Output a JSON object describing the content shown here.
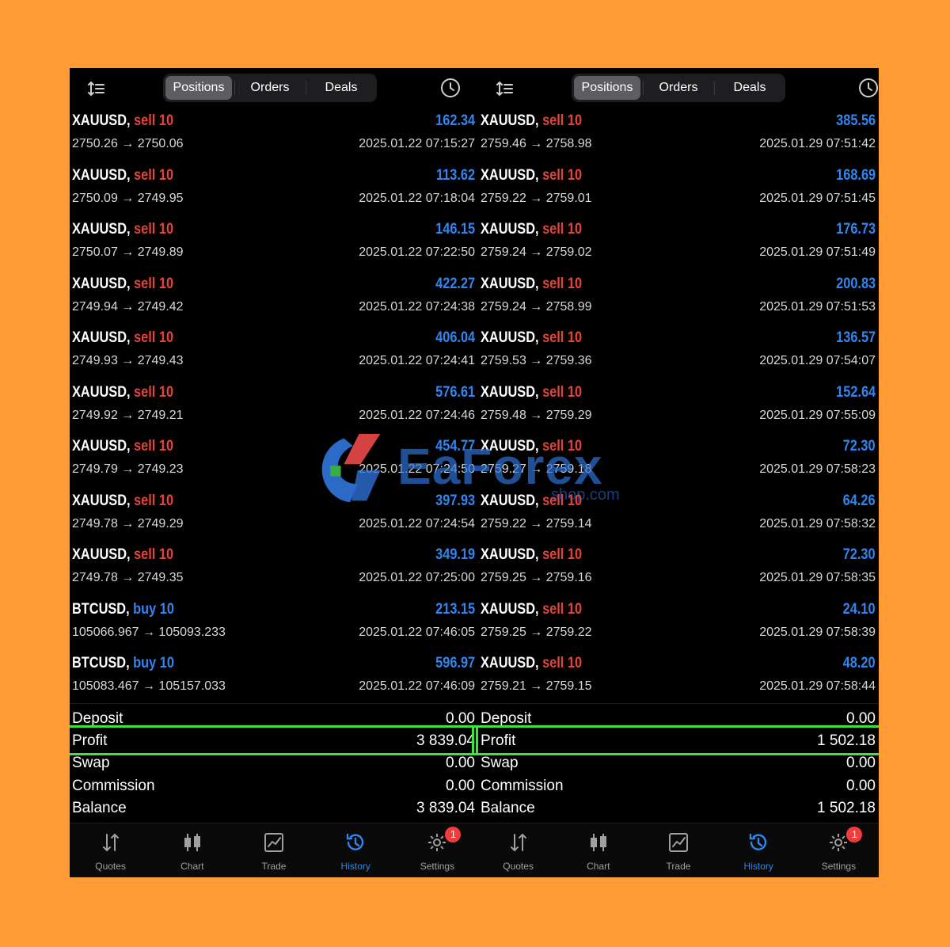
{
  "colors": {
    "background": "#FF9B35",
    "profit_blue": "#2F86F0",
    "sell_red": "#E3443A",
    "highlight_green": "#3CE43C",
    "badge_red": "#F23B3B"
  },
  "panels": [
    {
      "tabs": [
        "Positions",
        "Orders",
        "Deals"
      ],
      "active_tab": "Positions",
      "trades": [
        {
          "symbol": "XAUUSD,",
          "direction": "sell",
          "lots": "10",
          "profit": "162.34",
          "prices": "2750.26 → 2750.06",
          "time": "2025.01.22 07:15:27"
        },
        {
          "symbol": "XAUUSD,",
          "direction": "sell",
          "lots": "10",
          "profit": "113.62",
          "prices": "2750.09 → 2749.95",
          "time": "2025.01.22 07:18:04"
        },
        {
          "symbol": "XAUUSD,",
          "direction": "sell",
          "lots": "10",
          "profit": "146.15",
          "prices": "2750.07 → 2749.89",
          "time": "2025.01.22 07:22:50"
        },
        {
          "symbol": "XAUUSD,",
          "direction": "sell",
          "lots": "10",
          "profit": "422.27",
          "prices": "2749.94 → 2749.42",
          "time": "2025.01.22 07:24:38"
        },
        {
          "symbol": "XAUUSD,",
          "direction": "sell",
          "lots": "10",
          "profit": "406.04",
          "prices": "2749.93 → 2749.43",
          "time": "2025.01.22 07:24:41"
        },
        {
          "symbol": "XAUUSD,",
          "direction": "sell",
          "lots": "10",
          "profit": "576.61",
          "prices": "2749.92 → 2749.21",
          "time": "2025.01.22 07:24:46"
        },
        {
          "symbol": "XAUUSD,",
          "direction": "sell",
          "lots": "10",
          "profit": "454.77",
          "prices": "2749.79 → 2749.23",
          "time": "2025.01.22 07:24:50"
        },
        {
          "symbol": "XAUUSD,",
          "direction": "sell",
          "lots": "10",
          "profit": "397.93",
          "prices": "2749.78 → 2749.29",
          "time": "2025.01.22 07:24:54"
        },
        {
          "symbol": "XAUUSD,",
          "direction": "sell",
          "lots": "10",
          "profit": "349.19",
          "prices": "2749.78 → 2749.35",
          "time": "2025.01.22 07:25:00"
        },
        {
          "symbol": "BTCUSD,",
          "direction": "buy",
          "lots": "10",
          "profit": "213.15",
          "prices": "105066.967 → 105093.233",
          "time": "2025.01.22 07:46:05"
        },
        {
          "symbol": "BTCUSD,",
          "direction": "buy",
          "lots": "10",
          "profit": "596.97",
          "prices": "105083.467 → 105157.033",
          "time": "2025.01.22 07:46:09"
        }
      ],
      "summary": [
        {
          "label": "Deposit",
          "value": "0.00"
        },
        {
          "label": "Profit",
          "value": "3 839.04"
        },
        {
          "label": "Swap",
          "value": "0.00"
        },
        {
          "label": "Commission",
          "value": "0.00"
        },
        {
          "label": "Balance",
          "value": "3 839.04"
        }
      ],
      "nav": [
        {
          "label": "Quotes",
          "icon": "quotes-icon"
        },
        {
          "label": "Chart",
          "icon": "chart-icon"
        },
        {
          "label": "Trade",
          "icon": "trade-icon"
        },
        {
          "label": "History",
          "icon": "history-icon"
        },
        {
          "label": "Settings",
          "icon": "settings-icon",
          "badge": "1"
        }
      ],
      "active_nav": "History"
    },
    {
      "tabs": [
        "Positions",
        "Orders",
        "Deals"
      ],
      "active_tab": "Positions",
      "trades": [
        {
          "symbol": "XAUUSD,",
          "direction": "sell",
          "lots": "10",
          "profit": "385.56",
          "prices": "2759.46 → 2758.98",
          "time": "2025.01.29 07:51:42"
        },
        {
          "symbol": "XAUUSD,",
          "direction": "sell",
          "lots": "10",
          "profit": "168.69",
          "prices": "2759.22 → 2759.01",
          "time": "2025.01.29 07:51:45"
        },
        {
          "symbol": "XAUUSD,",
          "direction": "sell",
          "lots": "10",
          "profit": "176.73",
          "prices": "2759.24 → 2759.02",
          "time": "2025.01.29 07:51:49"
        },
        {
          "symbol": "XAUUSD,",
          "direction": "sell",
          "lots": "10",
          "profit": "200.83",
          "prices": "2759.24 → 2758.99",
          "time": "2025.01.29 07:51:53"
        },
        {
          "symbol": "XAUUSD,",
          "direction": "sell",
          "lots": "10",
          "profit": "136.57",
          "prices": "2759.53 → 2759.36",
          "time": "2025.01.29 07:54:07"
        },
        {
          "symbol": "XAUUSD,",
          "direction": "sell",
          "lots": "10",
          "profit": "152.64",
          "prices": "2759.48 → 2759.29",
          "time": "2025.01.29 07:55:09"
        },
        {
          "symbol": "XAUUSD,",
          "direction": "sell",
          "lots": "10",
          "profit": "72.30",
          "prices": "2759.27 → 2759.18",
          "time": "2025.01.29 07:58:23"
        },
        {
          "symbol": "XAUUSD,",
          "direction": "sell",
          "lots": "10",
          "profit": "64.26",
          "prices": "2759.22 → 2759.14",
          "time": "2025.01.29 07:58:32"
        },
        {
          "symbol": "XAUUSD,",
          "direction": "sell",
          "lots": "10",
          "profit": "72.30",
          "prices": "2759.25 → 2759.16",
          "time": "2025.01.29 07:58:35"
        },
        {
          "symbol": "XAUUSD,",
          "direction": "sell",
          "lots": "10",
          "profit": "24.10",
          "prices": "2759.25 → 2759.22",
          "time": "2025.01.29 07:58:39"
        },
        {
          "symbol": "XAUUSD,",
          "direction": "sell",
          "lots": "10",
          "profit": "48.20",
          "prices": "2759.21 → 2759.15",
          "time": "2025.01.29 07:58:44"
        }
      ],
      "summary": [
        {
          "label": "Deposit",
          "value": "0.00"
        },
        {
          "label": "Profit",
          "value": "1 502.18"
        },
        {
          "label": "Swap",
          "value": "0.00"
        },
        {
          "label": "Commission",
          "value": "0.00"
        },
        {
          "label": "Balance",
          "value": "1 502.18"
        }
      ],
      "nav": [
        {
          "label": "Quotes",
          "icon": "quotes-icon"
        },
        {
          "label": "Chart",
          "icon": "chart-icon"
        },
        {
          "label": "Trade",
          "icon": "trade-icon"
        },
        {
          "label": "History",
          "icon": "history-icon"
        },
        {
          "label": "Settings",
          "icon": "settings-icon",
          "badge": "1"
        }
      ],
      "active_nav": "History"
    }
  ],
  "watermark": {
    "brand": "EaForex",
    "sub": "shop.com",
    "logo_icon": "eaforex-logo-icon"
  }
}
